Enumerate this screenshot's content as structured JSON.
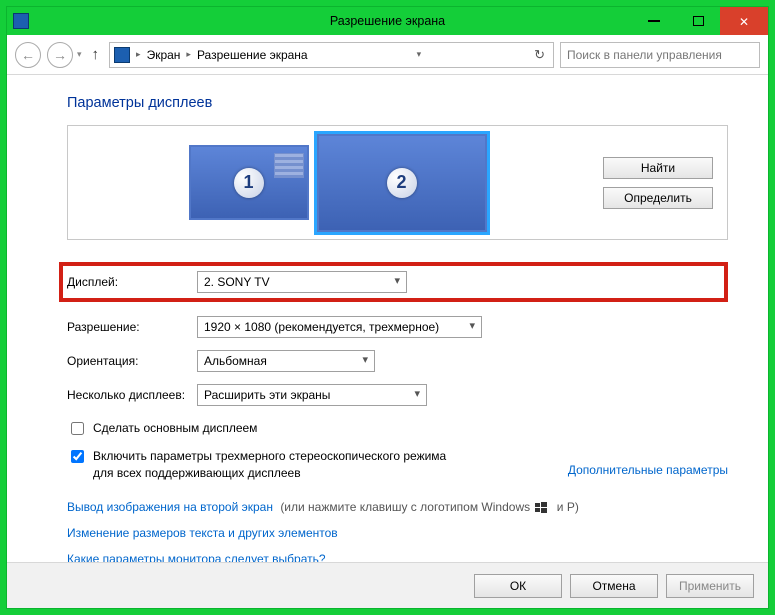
{
  "titlebar": {
    "title": "Разрешение экрана"
  },
  "toolbar": {
    "breadcrumb": [
      "Экран",
      "Разрешение экрана"
    ],
    "search_placeholder": "Поиск в панели управления"
  },
  "heading": "Параметры дисплеев",
  "panel": {
    "monitor1": "1",
    "monitor2": "2",
    "find_button": "Найти",
    "identify_button": "Определить"
  },
  "form": {
    "display_label": "Дисплей:",
    "display_value": "2. SONY TV",
    "resolution_label": "Разрешение:",
    "resolution_value": "1920 × 1080 (рекомендуется, трехмерное)",
    "orientation_label": "Ориентация:",
    "orientation_value": "Альбомная",
    "multi_label": "Несколько дисплеев:",
    "multi_value": "Расширить эти экраны"
  },
  "checkboxes": {
    "make_main": "Сделать основным дисплеем",
    "enable_3d": "Включить параметры трехмерного стереоскопического режима для всех поддерживающих дисплеев"
  },
  "links": {
    "advanced": "Дополнительные параметры",
    "project": "Вывод изображения на второй экран",
    "project_hint": "(или нажмите клавишу с логотипом Windows",
    "project_hint_tail": "и P)",
    "text_size": "Изменение размеров текста и других элементов",
    "which_monitor": "Какие параметры монитора следует выбрать?"
  },
  "footer": {
    "ok": "ОК",
    "cancel": "Отмена",
    "apply": "Применить"
  }
}
